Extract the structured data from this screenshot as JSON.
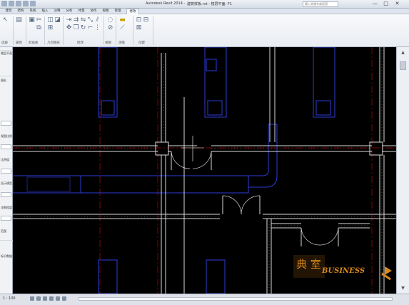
{
  "app": {
    "title": "Autodesk Revit 2014 -",
    "document": "建筑样板.rvt - 楼层平面: F1",
    "search_placeholder": "键入关键字或短语"
  },
  "tabs": [
    {
      "label": "建筑"
    },
    {
      "label": "结构"
    },
    {
      "label": "系统"
    },
    {
      "label": "插入"
    },
    {
      "label": "注释"
    },
    {
      "label": "分析"
    },
    {
      "label": "体量"
    },
    {
      "label": "协作"
    },
    {
      "label": "视图"
    },
    {
      "label": "管理"
    },
    {
      "label": "修改",
      "active": true
    }
  ],
  "ribbon": {
    "panels": [
      {
        "label": "选择"
      },
      {
        "label": "属性"
      },
      {
        "label": "剪贴板"
      },
      {
        "label": "几何图形"
      },
      {
        "label": "修改"
      },
      {
        "label": "视图"
      },
      {
        "label": "测量"
      },
      {
        "label": "创建"
      }
    ]
  },
  "properties_panel": {
    "rows": [
      {
        "label": "楼层平面"
      },
      {
        "label": "图形"
      },
      {
        "label": "视图比例"
      },
      {
        "label": "比例值"
      },
      {
        "label": "显示模型"
      },
      {
        "label": "详细程度"
      },
      {
        "label": "范围"
      },
      {
        "label": "标识数据"
      }
    ]
  },
  "drawing": {
    "wall_color": "#d8d8d8",
    "duct_color": "#2d3bd6",
    "grid_color": "#a60000",
    "background": "#000000"
  },
  "logo": {
    "cn_text": "典 室",
    "en_text": "BUSINESS",
    "color": "#d9881a"
  },
  "statusbar": {
    "scale": "1 : 100"
  },
  "window_controls": {
    "minimize": "—",
    "maximize": "□",
    "close": "✕"
  }
}
